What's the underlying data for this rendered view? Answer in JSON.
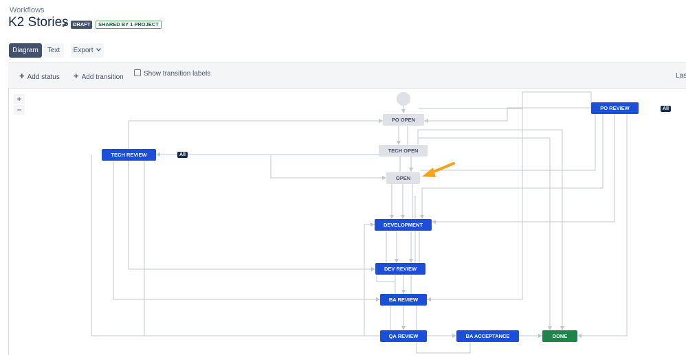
{
  "breadcrumb": "Workflows",
  "title": "K2 Stories",
  "badges": {
    "draft": "DRAFT",
    "shared": "SHARED BY 1 PROJECT"
  },
  "view_tabs": {
    "diagram": "Diagram",
    "text": "Text",
    "export": "Export"
  },
  "toolbar": {
    "add_status": "Add status",
    "add_transition": "Add transition",
    "show_transition_labels": "Show transition labels",
    "last_cut": "Last"
  },
  "zoom": {
    "in": "+",
    "out": "−"
  },
  "statuses": {
    "po_open": "PO OPEN",
    "tech_open": "TECH OPEN",
    "open": "OPEN",
    "development": "DEVELOPMENT",
    "dev_review": "DEV REVIEW",
    "ba_review": "BA REVIEW",
    "qa_review": "QA REVIEW",
    "ba_acceptance": "BA ACCEPTANCE",
    "done": "DONE",
    "tech_review": "TECH REVIEW",
    "po_review": "PO REVIEW"
  },
  "all_badge": "All",
  "colors": {
    "status_todo": "#dfe1e6",
    "status_in_progress": "#1d4ed8",
    "status_done": "#1e8449",
    "connector": "#c1c7d0",
    "annotation_arrow": "#f6a31b"
  }
}
